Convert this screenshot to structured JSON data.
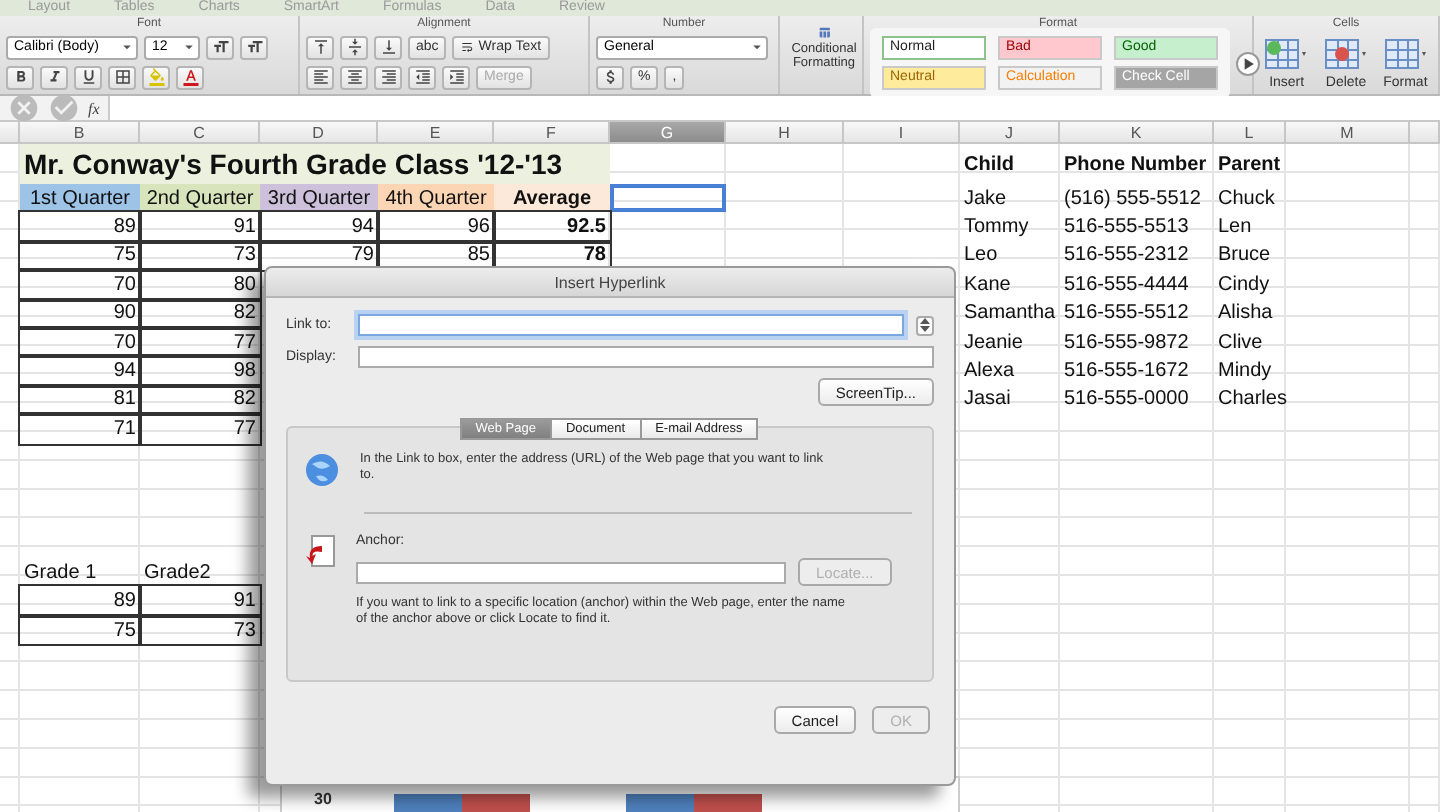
{
  "ribbon": {
    "tabs": [
      "Layout",
      "Tables",
      "Charts",
      "SmartArt",
      "Formulas",
      "Data",
      "Review"
    ],
    "group_labels": [
      "Font",
      "Alignment",
      "Number",
      "Format",
      "Cells"
    ],
    "font_name": "Calibri (Body)",
    "font_size": "12",
    "orientation": "abc",
    "wrap_text": "Wrap Text",
    "merge": {
      "label": "Merge",
      "disabled": true
    },
    "number_format": "General",
    "percent": "%",
    "comma": ",",
    "conditional_formatting": "Conditional Formatting",
    "styles": [
      {
        "label": "Normal",
        "color": "#ffffff",
        "kind": "normal"
      },
      {
        "label": "Bad",
        "color": "#ffc7ce",
        "kind": "bad"
      },
      {
        "label": "Good",
        "color": "#c6efce",
        "kind": "good"
      },
      {
        "label": "Neutral",
        "color": "#ffeb9c",
        "kind": "neutral"
      },
      {
        "label": "Calculation",
        "color": "#f2f2f2",
        "kind": "calculation"
      },
      {
        "label": "Check Cell",
        "color": "#a5a5a5",
        "kind": "check"
      }
    ],
    "cells_buttons": [
      "Insert",
      "Delete",
      "Format"
    ]
  },
  "formula_bar": {
    "function_label": "fx"
  },
  "sheet": {
    "columns": [
      {
        "label": "B",
        "selected": false
      },
      {
        "label": "C",
        "selected": false
      },
      {
        "label": "D",
        "selected": false
      },
      {
        "label": "E",
        "selected": false
      },
      {
        "label": "F",
        "selected": false
      },
      {
        "label": "G",
        "selected": true
      },
      {
        "label": "H",
        "selected": false
      },
      {
        "label": "I",
        "selected": false
      },
      {
        "label": "J",
        "selected": false
      },
      {
        "label": "K",
        "selected": false
      },
      {
        "label": "L",
        "selected": false
      },
      {
        "label": "M",
        "selected": false
      }
    ],
    "title": "Mr. Conway's Fourth Grade Class '12-'13",
    "quarter_headers": [
      {
        "label": "1st Quarter",
        "color": "#9dc3e6"
      },
      {
        "label": "2nd Quarter",
        "color": "#d8e4bc"
      },
      {
        "label": "3rd Quarter",
        "color": "#ccc0da"
      },
      {
        "label": "4th Quarter",
        "color": "#fcd5b4"
      },
      {
        "label": "Average",
        "color": "#fde9d9"
      }
    ],
    "scores": [
      [
        "89",
        "91",
        "94",
        "96",
        "92.5"
      ],
      [
        "75",
        "73",
        "79",
        "85",
        "78"
      ],
      [
        "70",
        "80"
      ],
      [
        "90",
        "82"
      ],
      [
        "70",
        "77"
      ],
      [
        "94",
        "98"
      ],
      [
        "81",
        "82"
      ],
      [
        "71",
        "77"
      ]
    ],
    "grade_headers": [
      "Grade 1",
      "Grade2"
    ],
    "grades": [
      [
        "89",
        "91"
      ],
      [
        "75",
        "73"
      ]
    ],
    "contacts": {
      "columns": [
        "Child",
        "Phone Number",
        "Parent"
      ],
      "rows": [
        [
          "Jake",
          "(516) 555-5512",
          "Chuck"
        ],
        [
          "Tommy",
          "516-555-5513",
          "Len"
        ],
        [
          "Leo",
          "516-555-2312",
          "Bruce"
        ],
        [
          "Kane",
          "516-555-4444",
          "Cindy"
        ],
        [
          "Samantha",
          "516-555-5512",
          "Alisha"
        ],
        [
          "Jeanie",
          "516-555-9872",
          "Clive"
        ],
        [
          "Alexa",
          "516-555-1672",
          "Mindy"
        ],
        [
          "Jasai",
          "516-555-0000",
          "Charles"
        ]
      ]
    },
    "chart": {
      "axis_label": "30"
    }
  },
  "dialog": {
    "title": "Insert Hyperlink",
    "link_label": "Link to:",
    "display_label": "Display:",
    "screentip": "ScreenTip...",
    "tabs": [
      {
        "label": "Web Page",
        "selected": true
      },
      {
        "label": "Document",
        "selected": false
      },
      {
        "label": "E-mail Address",
        "selected": false
      }
    ],
    "web_page_hint": "In the Link to box, enter the address (URL) of the Web page that you want to link to.",
    "anchor_label": "Anchor:",
    "locate": {
      "label": "Locate...",
      "disabled": true
    },
    "anchor_hint": "If you want to link to a specific location (anchor) within the Web page, enter the name of the anchor above or click Locate to find it.",
    "buttons": [
      {
        "label": "Cancel",
        "disabled": false
      },
      {
        "label": "OK",
        "disabled": true
      }
    ]
  }
}
